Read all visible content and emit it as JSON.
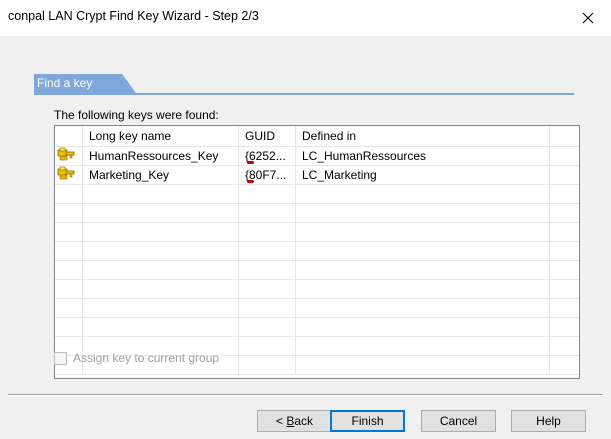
{
  "window": {
    "title": "conpal LAN Crypt Find Key Wizard - Step 2/3",
    "close_icon": "close-icon"
  },
  "tab": {
    "label": "Find a key"
  },
  "found_label": "The following keys were found:",
  "list": {
    "columns": [
      "",
      "Long key name",
      "GUID",
      "Defined in",
      ""
    ],
    "rows": [
      {
        "icon": "key-icon",
        "name": "HumanRessources_Key",
        "guid": "{6252...",
        "defined_in": "LC_HumanRessources"
      },
      {
        "icon": "key-icon",
        "name": "Marketing_Key",
        "guid": "{80F7...",
        "defined_in": "LC_Marketing"
      }
    ],
    "empty_row_count": 10
  },
  "checkbox": {
    "label": "Assign key to current group",
    "checked": false,
    "enabled": false
  },
  "buttons": {
    "back_prefix": "< ",
    "back_accel": "B",
    "back_rest": "ack",
    "finish": "Finish",
    "cancel": "Cancel",
    "help": "Help"
  },
  "colors": {
    "tab": "#7fa7d9",
    "dialog_bg": "#f0f0f0"
  }
}
